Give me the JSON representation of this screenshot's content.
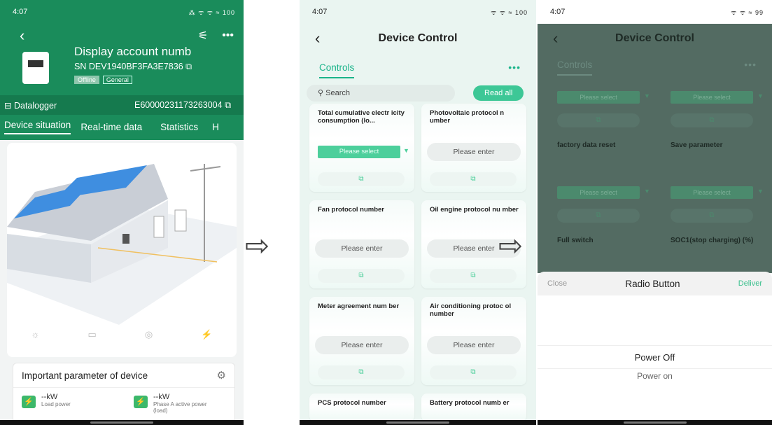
{
  "phone1": {
    "status": {
      "time": "4:07",
      "right": "⁂ ᯤ ᯤ ≈ 100"
    },
    "device_name": "Display account numb",
    "sn": "SN DEV1940BF3FA3E7836",
    "tags": [
      "Offline",
      "General"
    ],
    "datalogger_label": "Datalogger",
    "datalogger_sn": "E60000231173263004",
    "tabs": [
      "Device situation",
      "Real-time data",
      "Statistics",
      "H"
    ],
    "params_title": "Important parameter of device",
    "params": [
      {
        "value": "--kW",
        "label": "Load power"
      },
      {
        "value": "--kW",
        "label": "Phase A active power (load)"
      }
    ]
  },
  "phone2": {
    "status": {
      "time": "4:07",
      "right": "ᯤ ᯤ ≈ 100"
    },
    "title": "Device Control",
    "controls_tab": "Controls",
    "search_placeholder": "Search",
    "read_all": "Read all",
    "cards": [
      {
        "title": "Total cumulative electr icity consumption (lo...",
        "kind": "select",
        "value": "Please select"
      },
      {
        "title": "Photovoltaic protocol n umber",
        "kind": "input",
        "value": "Please enter"
      },
      {
        "title": "Fan protocol number",
        "kind": "input",
        "value": "Please enter"
      },
      {
        "title": "Oil engine protocol nu mber",
        "kind": "input",
        "value": "Please enter"
      },
      {
        "title": "Meter agreement num ber",
        "kind": "input",
        "value": "Please enter"
      },
      {
        "title": "Air conditioning protoc ol number",
        "kind": "input",
        "value": "Please enter"
      },
      {
        "title": "PCS protocol number",
        "kind": "short"
      },
      {
        "title": "Battery protocol numb er",
        "kind": "short"
      }
    ]
  },
  "phone3": {
    "status": {
      "time": "4:07",
      "right": "ᯤ ᯤ ≈ 99"
    },
    "title": "Device Control",
    "controls_tab": "Controls",
    "cells": [
      {
        "select": "Please select",
        "label": "factory data reset"
      },
      {
        "select": "Please select",
        "label": "Save parameter"
      },
      {
        "select": "Please select",
        "label": "Full switch"
      },
      {
        "select": "Please select",
        "label": "SOC1(stop charging) (%)"
      }
    ],
    "sheet": {
      "close": "Close",
      "title": "Radio Button",
      "deliver": "Deliver",
      "options": [
        "Power Off",
        "Power on"
      ]
    }
  }
}
